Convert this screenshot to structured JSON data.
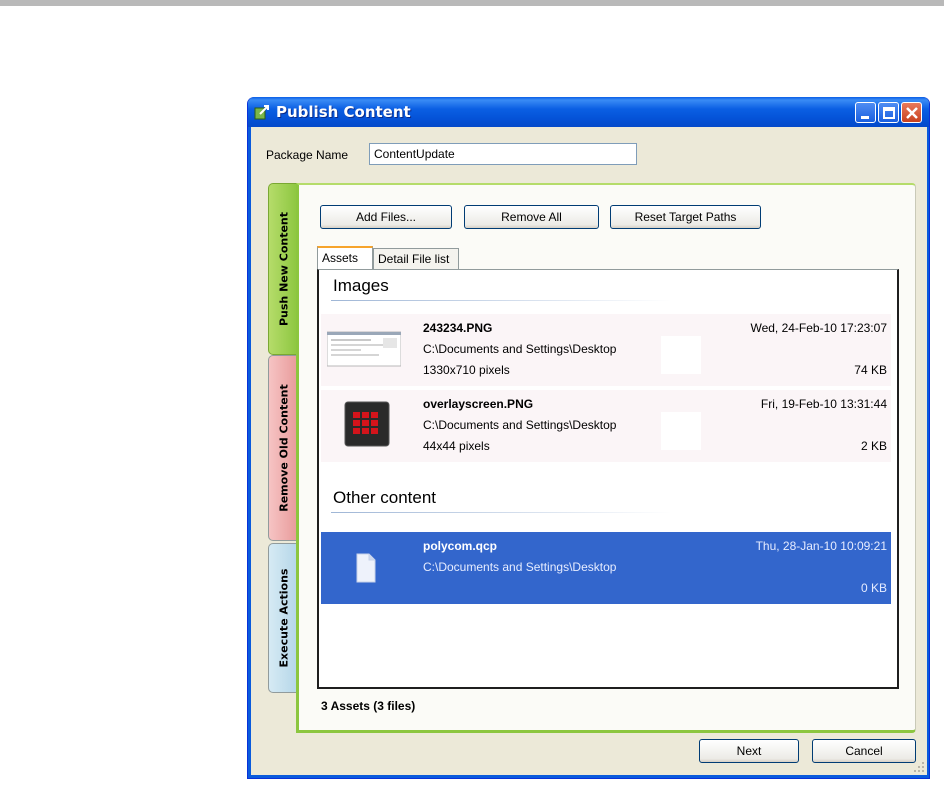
{
  "window": {
    "title": "Publish Content"
  },
  "package": {
    "label": "Package Name",
    "value": "ContentUpdate"
  },
  "side_tabs": [
    {
      "label": "Push New Content",
      "color": "#8cc63f",
      "selected": true
    },
    {
      "label": "Remove Old Content",
      "color": "#e89a9a",
      "selected": false
    },
    {
      "label": "Execute Actions",
      "color": "#b4d6e8",
      "selected": false
    }
  ],
  "toolbar": {
    "add_files": "Add Files...",
    "remove_all": "Remove All",
    "reset_paths": "Reset Target Paths"
  },
  "tabs": [
    {
      "label": "Assets",
      "selected": true
    },
    {
      "label": "Detail File list",
      "selected": false
    }
  ],
  "sections": {
    "images": "Images",
    "other": "Other content"
  },
  "items": [
    {
      "name": "243234.PNG",
      "path": "C:\\Documents and Settings\\Desktop",
      "dims": "1330x710 pixels",
      "date": "Wed, 24-Feb-10 17:23:07",
      "size": "74 KB",
      "icon": "screenshot-thumbnail-icon"
    },
    {
      "name": "overlayscreen.PNG",
      "path": "C:\\Documents and Settings\\Desktop",
      "dims": "44x44 pixels",
      "date": "Fri, 19-Feb-10 13:31:44",
      "size": "2 KB",
      "icon": "grid-thumbnail-icon"
    },
    {
      "name": "polycom.qcp",
      "path": "C:\\Documents and Settings\\Desktop",
      "dims": "",
      "date": "Thu, 28-Jan-10 10:09:21",
      "size": "0 KB",
      "icon": "file-icon",
      "selected": true
    }
  ],
  "status": "3 Assets (3 files)",
  "footer": {
    "next": "Next",
    "cancel": "Cancel"
  },
  "colors": {
    "titlebar": "#0553d8",
    "selection": "#3366cc",
    "accent_green": "#8cc63f"
  }
}
